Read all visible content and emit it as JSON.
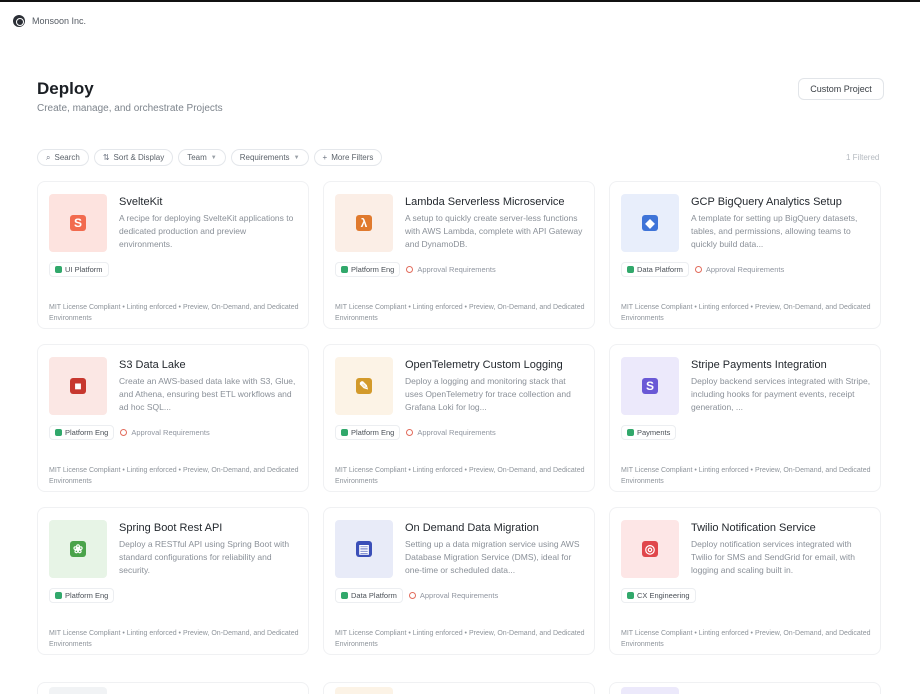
{
  "org": {
    "name": "Monsoon Inc."
  },
  "header": {
    "title": "Deploy",
    "subtitle": "Create, manage, and orchestrate Projects",
    "custom_project_label": "Custom Project"
  },
  "filters": {
    "search": "Search",
    "sort": "Sort & Display",
    "team": "Team",
    "requirements": "Requirements",
    "more": "More Filters",
    "view_count": "1 Filtered"
  },
  "colors": {
    "accent_green": "#31a86b",
    "requirement_red": "#e26c5c"
  },
  "cards": [
    {
      "title": "SvelteKit",
      "description": "A recipe for deploying SvelteKit applications to dedicated production and preview environments.",
      "team": "UI Platform",
      "requirement": "",
      "footer": "MIT License Compliant • Linting enforced • Preview, On-Demand, and Dedicated Environments",
      "icon": "sveltekit-logo-icon",
      "tile_color": "#fde3df",
      "glyph_color": "#f26b4f"
    },
    {
      "title": "Lambda Serverless Microservice",
      "description": "A setup to quickly create server-less functions with AWS Lambda, complete with API Gateway and DynamoDB.",
      "team": "Platform Eng",
      "requirement": "Approval Requirements",
      "footer": "MIT License Compliant • Linting enforced • Preview, On-Demand, and Dedicated Environments",
      "icon": "aws-lambda-icon",
      "tile_color": "#fbeee6",
      "glyph_color": "#e07a2e"
    },
    {
      "title": "GCP BigQuery Analytics Setup",
      "description": "A template for setting up BigQuery datasets, tables, and permissions, allowing teams to quickly build data...",
      "team": "Data Platform",
      "requirement": "Approval Requirements",
      "footer": "MIT License Compliant • Linting enforced • Preview, On-Demand, and Dedicated Environments",
      "icon": "bigquery-icon",
      "tile_color": "#e8eefb",
      "glyph_color": "#3f74d8"
    },
    {
      "title": "S3 Data Lake",
      "description": "Create an AWS-based data lake with S3, Glue, and Athena, ensuring best ETL workflows and ad hoc SQL...",
      "team": "Platform Eng",
      "requirement": "Approval Requirements",
      "footer": "MIT License Compliant • Linting enforced • Preview, On-Demand, and Dedicated Environments",
      "icon": "aws-s3-icon",
      "tile_color": "#fbe7e4",
      "glyph_color": "#c7382f"
    },
    {
      "title": "OpenTelemetry Custom Logging",
      "description": "Deploy a logging and monitoring stack that uses OpenTelemetry for trace collection and Grafana Loki for log...",
      "team": "Platform Eng",
      "requirement": "Approval Requirements",
      "footer": "MIT License Compliant • Linting enforced • Preview, On-Demand, and Dedicated Environments",
      "icon": "opentelemetry-icon",
      "tile_color": "#fcf3e6",
      "glyph_color": "#d39a2b"
    },
    {
      "title": "Stripe Payments Integration",
      "description": "Deploy backend services integrated with Stripe, including hooks for payment events, receipt generation, ...",
      "team": "Payments",
      "requirement": "",
      "footer": "MIT License Compliant • Linting enforced • Preview, On-Demand, and Dedicated Environments",
      "icon": "stripe-icon",
      "tile_color": "#ece9fb",
      "glyph_color": "#6a59d6"
    },
    {
      "title": "Spring Boot Rest API",
      "description": "Deploy a RESTful API using Spring Boot with standard configurations for reliability and security.",
      "team": "Platform Eng",
      "requirement": "",
      "footer": "MIT License Compliant • Linting enforced • Preview, On-Demand, and Dedicated Environments",
      "icon": "spring-boot-icon",
      "tile_color": "#e7f4e6",
      "glyph_color": "#4aa34a"
    },
    {
      "title": "On Demand Data Migration",
      "description": "Setting up a data migration service using AWS Database Migration Service (DMS), ideal for one-time or scheduled data...",
      "team": "Data Platform",
      "requirement": "Approval Requirements",
      "footer": "MIT License Compliant • Linting enforced • Preview, On-Demand, and Dedicated Environments",
      "icon": "aws-dms-icon",
      "tile_color": "#e8ebf8",
      "glyph_color": "#3b4fb8"
    },
    {
      "title": "Twilio Notification Service",
      "description": "Deploy notification services integrated with Twilio for SMS and SendGrid for email, with logging and scaling built in.",
      "team": "CX Engineering",
      "requirement": "",
      "footer": "MIT License Compliant • Linting enforced • Preview, On-Demand, and Dedicated Environments",
      "icon": "twilio-icon",
      "tile_color": "#fde6e6",
      "glyph_color": "#e0474c"
    }
  ]
}
